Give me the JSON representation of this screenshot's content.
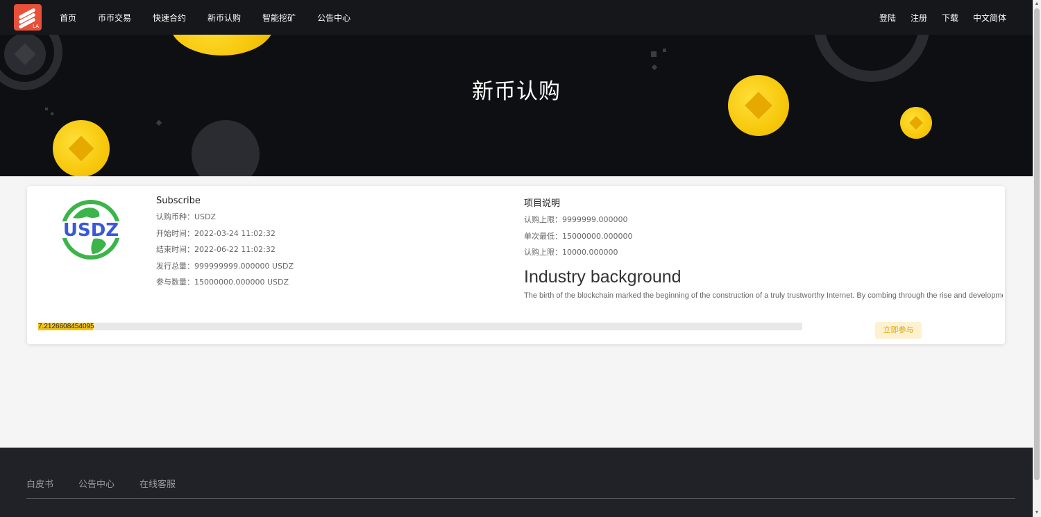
{
  "nav": {
    "left": [
      "首页",
      "币币交易",
      "快速合约",
      "新币认购",
      "智能挖矿",
      "公告中心"
    ],
    "right": [
      "登陆",
      "注册",
      "下载",
      "中文简体"
    ],
    "logo_text": "LA"
  },
  "banner": {
    "title": "新币认购"
  },
  "project": {
    "logo_text": "USDZ",
    "section_title": "Subscribe",
    "details": [
      {
        "label": "认购币种：",
        "value": "USDZ"
      },
      {
        "label": "开始时间：",
        "value": "2022-03-24 11:02:32"
      },
      {
        "label": "结束时间：",
        "value": "2022-06-22 11:02:32"
      },
      {
        "label": "发行总量：",
        "value": "999999999.000000 USDZ"
      },
      {
        "label": "参与数量：",
        "value": "15000000.000000 USDZ"
      }
    ],
    "desc_title": "项目说明",
    "limits": [
      {
        "label": "认购上限：",
        "value": "9999999.000000"
      },
      {
        "label": "单次最低：",
        "value": "15000000.000000"
      },
      {
        "label": "认购上限：",
        "value": "10000.000000"
      }
    ],
    "industry_title": "Industry background",
    "industry_text": "The birth of the blockchain marked the beginning of the construction of a truly trustworthy Internet. By combing through the rise and development of blockchain technology",
    "progress_value": "7.2126608454095",
    "progress_percent": 7.2126608454095,
    "join_label": "立即参与"
  },
  "footer": {
    "links": [
      "白皮书",
      "公告中心",
      "在线客服"
    ]
  },
  "colors": {
    "accent": "#f2c314",
    "brand": "#e8503a",
    "dark": "#16171b"
  }
}
